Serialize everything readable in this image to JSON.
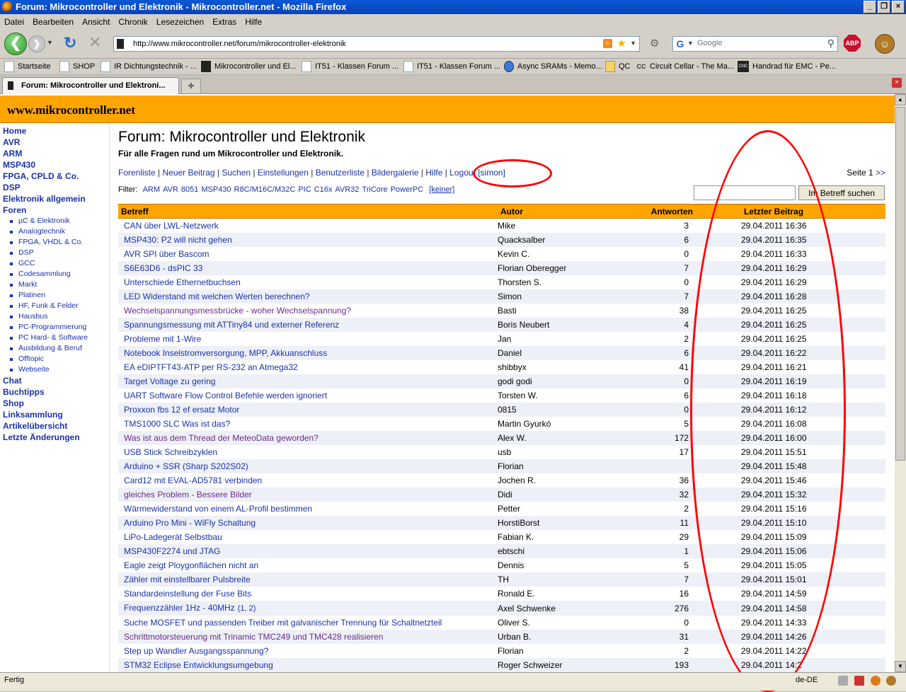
{
  "window": {
    "title": "Forum: Mikrocontroller und Elektronik - Mikrocontroller.net - Mozilla Firefox",
    "buttons": [
      "_",
      "❐",
      "×"
    ]
  },
  "menu": [
    "Datei",
    "Bearbeiten",
    "Ansicht",
    "Chronik",
    "Lesezeichen",
    "Extras",
    "Hilfe"
  ],
  "nav": {
    "url": "http://www.mikrocontroller.net/forum/mikrocontroller-elektronik",
    "search_placeholder": "Google"
  },
  "bookmarks": [
    "Startseite",
    "SHOP",
    "IR Dichtungstechnik - ...",
    "Mikrocontroller und El...",
    "IT51 - Klassen Forum ...",
    "IT51 - Klassen Forum ...",
    "Async SRAMs - Memo...",
    "QC",
    "Circuit Cellar - The Ma...",
    "Handrad für EMC - Pe..."
  ],
  "tab": {
    "label": "Forum: Mikrocontroller und Elektroni..."
  },
  "site": {
    "name": "www.mikrocontroller.net"
  },
  "sidebar": {
    "top": [
      "Home",
      "AVR",
      "ARM",
      "MSP430",
      "FPGA, CPLD & Co.",
      "DSP",
      "Elektronik allgemein",
      "Foren"
    ],
    "forums": [
      "µC & Elektronik",
      "Analogtechnik",
      "FPGA, VHDL & Co.",
      "DSP",
      "GCC",
      "Codesammlung",
      "Markt",
      "Platinen",
      "HF, Funk & Felder",
      "Hausbus",
      "PC-Programmierung",
      "PC Hard- & Software",
      "Ausbildung & Beruf",
      "Offtopic",
      "Webseite"
    ],
    "bottom": [
      "Chat",
      "Buchtipps",
      "Shop",
      "Linksammlung",
      "Artikelübersicht",
      "Letzte Änderungen"
    ]
  },
  "page": {
    "title": "Forum: Mikrocontroller und Elektronik",
    "subtitle": "Für alle Fragen rund um Mikrocontroller und Elektronik.",
    "links": [
      "Forenliste",
      "Neuer Beitrag",
      "Suchen",
      "Einstellungen",
      "Benutzerliste",
      "Bildergalerie",
      "Hilfe",
      "Logout [simon]"
    ],
    "separator": " | ",
    "seite_label": "Seite 1",
    "seite_next": ">>",
    "filter_label": "Filter:",
    "filters": [
      "ARM",
      "AVR",
      "8051",
      "MSP430",
      "R8C/M16C/M32C",
      "PIC",
      "C16x",
      "AVR32",
      "TriCore",
      "PowerPC"
    ],
    "filter_none": "[keiner]",
    "search_button": "Im Betreff suchen"
  },
  "table": {
    "headers": [
      "Betreff",
      "Autor",
      "Antworten",
      "Letzter Beitrag"
    ],
    "rows": [
      [
        "CAN über LWL-Netzwerk",
        "Mike",
        "3",
        "29.04.2011 16:36",
        false
      ],
      [
        "MSP430: P2 will nicht gehen",
        "Quacksalber",
        "6",
        "29.04.2011 16:35",
        false
      ],
      [
        "AVR SPI über Bascom",
        "Kevin C.",
        "0",
        "29.04.2011 16:33",
        false
      ],
      [
        "S6E63D6 - dsPIC 33",
        "Florian Oberegger",
        "7",
        "29.04.2011 16:29",
        false
      ],
      [
        "Unterschiede Ethernetbuchsen",
        "Thorsten S.",
        "0",
        "29.04.2011 16:29",
        false
      ],
      [
        "LED Widerstand mit welchen Werten berechnen?",
        "Simon",
        "7",
        "29.04.2011 16:28",
        false
      ],
      [
        "Wechselspannungsmessbrücke - woher Wechselspannung?",
        "Basti",
        "38",
        "29.04.2011 16:25",
        true
      ],
      [
        "Spannungsmessung mit ATTiny84 und externer Referenz",
        "Boris Neubert",
        "4",
        "29.04.2011 16:25",
        false
      ],
      [
        "Probleme mit 1-Wire",
        "Jan",
        "2",
        "29.04.2011 16:25",
        false
      ],
      [
        "Notebook Inselstromversorgung, MPP, Akkuanschluss",
        "Daniel",
        "6",
        "29.04.2011 16:22",
        false
      ],
      [
        "EA eDIPTFT43-ATP per RS-232 an Atmega32",
        "shibbyx",
        "41",
        "29.04.2011 16:21",
        false
      ],
      [
        "Target Voltage zu gering",
        "godi godi",
        "0",
        "29.04.2011 16:19",
        false
      ],
      [
        "UART Software Flow Control Befehle werden ignoriert",
        "Torsten W.",
        "6",
        "29.04.2011 16:18",
        false
      ],
      [
        "Proxxon fbs 12 ef ersatz Motor",
        "0815",
        "0",
        "29.04.2011 16:12",
        false
      ],
      [
        "TMS1000 SLC Was ist das?",
        "Martin Gyurkó",
        "5",
        "29.04.2011 16:08",
        false
      ],
      [
        "Was ist aus dem Thread der MeteoData geworden?",
        "Alex W.",
        "172",
        "29.04.2011 16:00",
        true
      ],
      [
        "USB Stick Schreibzyklen",
        "usb",
        "17",
        "29.04.2011 15:51",
        false
      ],
      [
        "Arduino + SSR (Sharp S202S02)",
        "Florian",
        "",
        "29.04.2011 15:48",
        false
      ],
      [
        "Card12 mit EVAL-AD5781 verbinden",
        "Jochen R.",
        "36",
        "29.04.2011 15:46",
        false
      ],
      [
        "gleiches Problem - Bessere Bilder",
        "Didi",
        "32",
        "29.04.2011 15:32",
        true
      ],
      [
        "Wärmewiderstand von einem AL-Profil bestimmen",
        "Petter",
        "2",
        "29.04.2011 15:16",
        false
      ],
      [
        "Arduino Pro Mini - WiFly Schaltung",
        "HorstiBorst",
        "11",
        "29.04.2011 15:10",
        false
      ],
      [
        "LiPo-Ladegerät Selbstbau",
        "Fabian K.",
        "29",
        "29.04.2011 15:09",
        false
      ],
      [
        "MSP430F2274 und JTAG",
        "ebtschi",
        "1",
        "29.04.2011 15:06",
        false
      ],
      [
        "Eagle zeigt Ploygonflächen nicht an",
        "Dennis",
        "5",
        "29.04.2011 15:05",
        false
      ],
      [
        "Zähler mit einstellbarer Pulsbreite",
        "TH",
        "7",
        "29.04.2011 15:01",
        false
      ],
      [
        "Standardeinstellung der Fuse Bits",
        "Ronald E.",
        "16",
        "29.04.2011 14:59",
        false
      ],
      [
        "Frequenzzähler 1Hz - 40MHz",
        "Axel Schwenke",
        "276",
        "29.04.2011 14:58",
        false,
        "(1, 2)"
      ],
      [
        "Suche MOSFET und passenden Treiber mit galvanischer Trennung für Schaltnetzteil",
        "Oliver S.",
        "0",
        "29.04.2011 14:33",
        false
      ],
      [
        "Schrittmotorsteuerung mit Trinamic TMC249 und TMC428 realisieren",
        "Urban B.",
        "31",
        "29.04.2011 14:26",
        true
      ],
      [
        "Step up Wandler Ausgangsspannung?",
        "Florian",
        "2",
        "29.04.2011 14:22",
        false
      ],
      [
        "STM32 Eclipse Entwicklungsumgebung",
        "Roger Schweizer",
        "193",
        "29.04.2011 14:2",
        false
      ]
    ]
  },
  "status": {
    "text": "Fertig",
    "lang": "de-DE"
  },
  "colors": {
    "header": "#ffa500",
    "link": "#1a32a8",
    "visited": "#6b2b8a",
    "annotation": "#ff0000"
  }
}
